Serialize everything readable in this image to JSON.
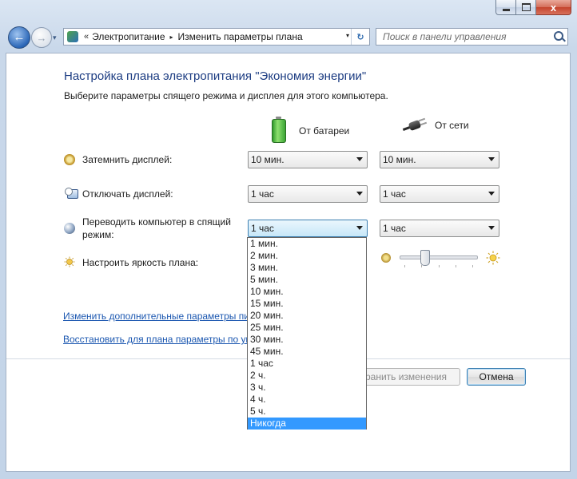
{
  "window": {
    "minimize_glyph": "",
    "close_glyph": "x"
  },
  "nav": {
    "back_glyph": "←",
    "forward_glyph": "→",
    "dropdown_glyph": "▾"
  },
  "address": {
    "overflow": "«",
    "crumbs": [
      "Электропитание",
      "Изменить параметры плана"
    ],
    "separator_glyph": "▸",
    "dropdown_glyph": "▾",
    "refresh_glyph": "↻"
  },
  "search": {
    "placeholder": "Поиск в панели управления",
    "icon": "search-icon"
  },
  "page": {
    "title": "Настройка плана электропитания \"Экономия энергии\"",
    "subtitle": "Выберите параметры спящего режима и дисплея для этого компьютера.",
    "col_battery": "От батареи",
    "col_ac": "От сети",
    "rows": {
      "dim": {
        "label": "Затемнить дисплей:",
        "battery": "10 мин.",
        "ac": "10 мин."
      },
      "off": {
        "label": "Отключать дисплей:",
        "battery": "1 час",
        "ac": "1 час"
      },
      "sleep": {
        "label_1": "Переводить компьютер в спящий",
        "label_2": "режим:",
        "battery": "1 час",
        "ac": "1 час"
      },
      "brightness": {
        "label": "Настроить яркость плана:",
        "level_percent": 30
      }
    },
    "links": {
      "advanced": "Изменить дополнительные параметры пи",
      "restore": "Восстановить для плана параметры по ум"
    },
    "buttons": {
      "save": "ранить изменения",
      "cancel": "Отмена"
    }
  },
  "dropdown": {
    "options": [
      "1 мин.",
      "2 мин.",
      "3 мин.",
      "5 мин.",
      "10 мин.",
      "15 мин.",
      "20 мин.",
      "25 мин.",
      "30 мин.",
      "45 мин.",
      "1 час",
      "2 ч.",
      "3 ч.",
      "4 ч.",
      "5 ч.",
      "Никогда"
    ],
    "selected": "Никогда"
  },
  "colors": {
    "title": "#1c3c82",
    "link": "#1b57b0",
    "selection": "#3399ff"
  }
}
